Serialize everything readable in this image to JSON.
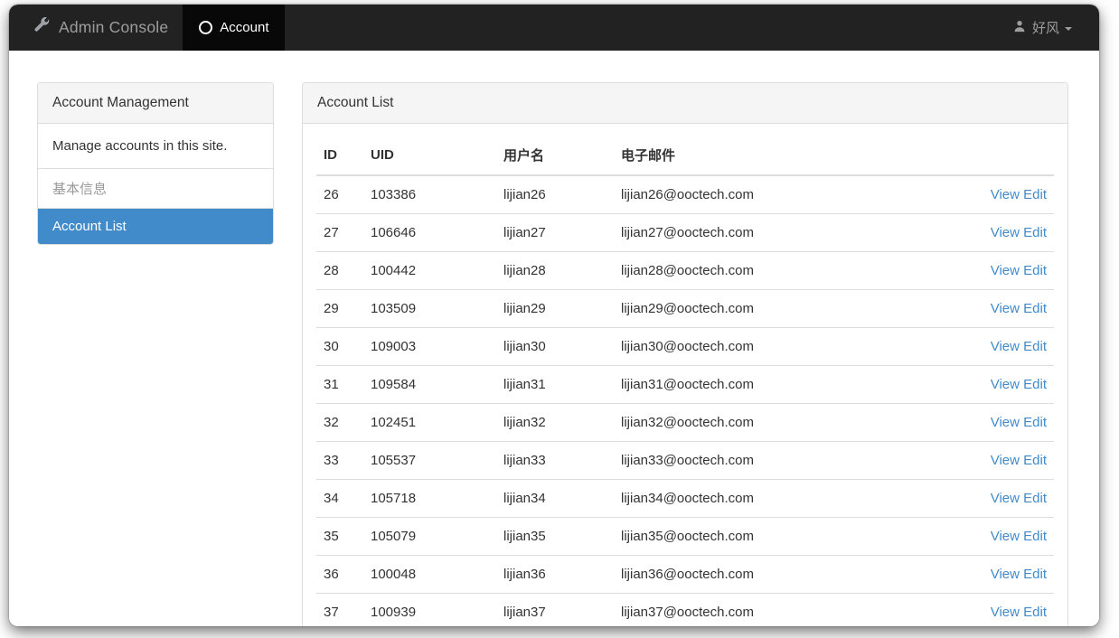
{
  "navbar": {
    "brand": "Admin Console",
    "brand_icon": "wrench-icon",
    "tab": "Account",
    "tab_icon": "circle-icon",
    "user_name": "好风",
    "user_icon": "user-icon",
    "caret_icon": "caret-down-icon",
    "bg_color": "#222222",
    "active_tab_color": "#080808"
  },
  "sidebar": {
    "heading": "Account Management",
    "description": "Manage accounts in this site.",
    "items": [
      {
        "label": "基本信息",
        "active": false
      },
      {
        "label": "Account List",
        "active": true
      }
    ],
    "active_color": "#428bca"
  },
  "panel": {
    "heading": "Account List",
    "columns": [
      "ID",
      "UID",
      "用户名",
      "电子邮件",
      ""
    ],
    "actions": {
      "view": "View",
      "edit": "Edit"
    },
    "link_color": "#428bca",
    "rows": [
      {
        "id": "26",
        "uid": "103386",
        "username": "lijian26",
        "email": "lijian26@ooctech.com"
      },
      {
        "id": "27",
        "uid": "106646",
        "username": "lijian27",
        "email": "lijian27@ooctech.com"
      },
      {
        "id": "28",
        "uid": "100442",
        "username": "lijian28",
        "email": "lijian28@ooctech.com"
      },
      {
        "id": "29",
        "uid": "103509",
        "username": "lijian29",
        "email": "lijian29@ooctech.com"
      },
      {
        "id": "30",
        "uid": "109003",
        "username": "lijian30",
        "email": "lijian30@ooctech.com"
      },
      {
        "id": "31",
        "uid": "109584",
        "username": "lijian31",
        "email": "lijian31@ooctech.com"
      },
      {
        "id": "32",
        "uid": "102451",
        "username": "lijian32",
        "email": "lijian32@ooctech.com"
      },
      {
        "id": "33",
        "uid": "105537",
        "username": "lijian33",
        "email": "lijian33@ooctech.com"
      },
      {
        "id": "34",
        "uid": "105718",
        "username": "lijian34",
        "email": "lijian34@ooctech.com"
      },
      {
        "id": "35",
        "uid": "105079",
        "username": "lijian35",
        "email": "lijian35@ooctech.com"
      },
      {
        "id": "36",
        "uid": "100048",
        "username": "lijian36",
        "email": "lijian36@ooctech.com"
      },
      {
        "id": "37",
        "uid": "100939",
        "username": "lijian37",
        "email": "lijian37@ooctech.com"
      }
    ]
  }
}
